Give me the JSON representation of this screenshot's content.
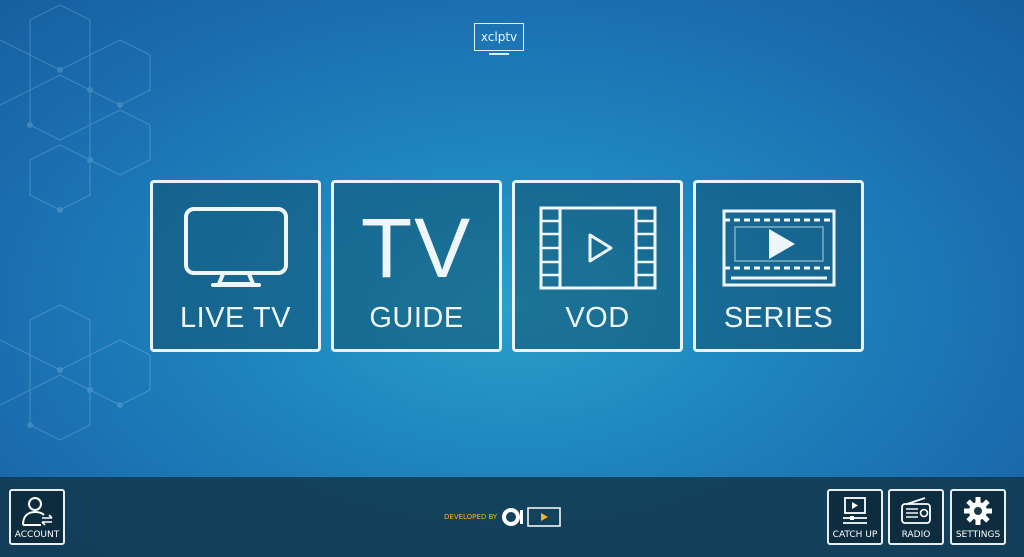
{
  "logo": {
    "text": "xclptv"
  },
  "tiles": [
    {
      "label": "LIVE TV",
      "icon": "monitor-icon"
    },
    {
      "label": "GUIDE",
      "icon": "tv-text-icon",
      "big_text": "TV"
    },
    {
      "label": "VOD",
      "icon": "film-play-icon"
    },
    {
      "label": "SERIES",
      "icon": "series-player-icon"
    }
  ],
  "bottom": {
    "account": {
      "label": "ACCOUNT",
      "icon": "user-swap-icon"
    },
    "catchup": {
      "label": "CATCH UP",
      "icon": "catchup-icon"
    },
    "radio": {
      "label": "RADIO",
      "icon": "radio-icon"
    },
    "settings": {
      "label": "SETTINGS",
      "icon": "gear-icon"
    }
  },
  "developer": {
    "text": "DEVELOPED BY"
  },
  "colors": {
    "accent": "#f0b429",
    "tile_border": "#e8f2f7",
    "bg": "#1f86bf"
  }
}
